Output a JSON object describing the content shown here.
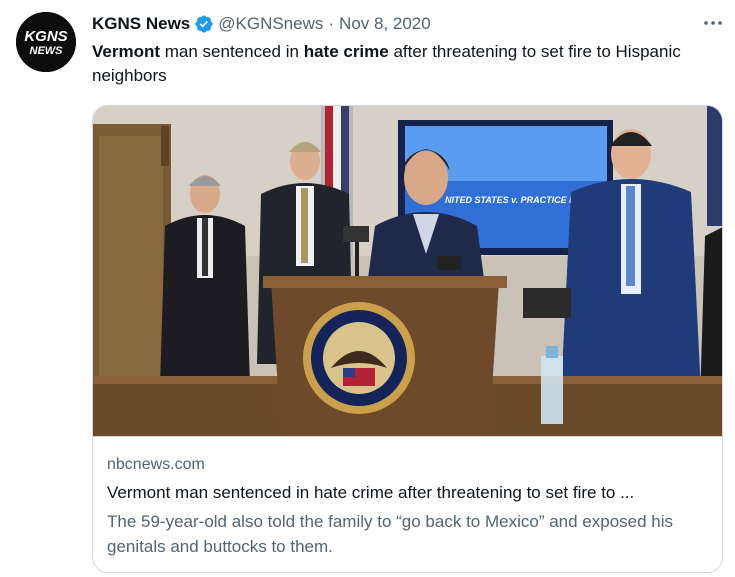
{
  "tweet": {
    "avatar_text": "KGNS\nNEWS",
    "display_name": "KGNS News",
    "verified_icon": "verified-badge-icon",
    "handle": "@KGNSnews",
    "separator": "·",
    "date": "Nov 8, 2020",
    "more_icon": "more-horizontal-icon",
    "text_parts": [
      {
        "text": "Vermont",
        "bold": true
      },
      {
        "text": " man sentenced in ",
        "bold": false
      },
      {
        "text": "hate crime",
        "bold": true
      },
      {
        "text": " after threatening to set fire to Hispanic neighbors",
        "bold": false
      }
    ]
  },
  "card": {
    "image_seal_text_top": "DEPARTMENT OF JUSTICE",
    "image_seal_text_bottom": "DISTRICT OF VERMONT",
    "image_screen_text": "NITED STATES v. PRACTICE FUSI",
    "domain": "nbcnews.com",
    "title": "Vermont man sentenced in hate crime after threatening to set fire to ...",
    "description": "The 59-year-old also told the family to “go back to Mexico” and exposed his genitals and buttocks to them."
  },
  "colors": {
    "text_primary": "#0f1419",
    "text_secondary": "#536471",
    "verified_blue": "#1d9bf0",
    "card_border": "#cfd9de"
  }
}
